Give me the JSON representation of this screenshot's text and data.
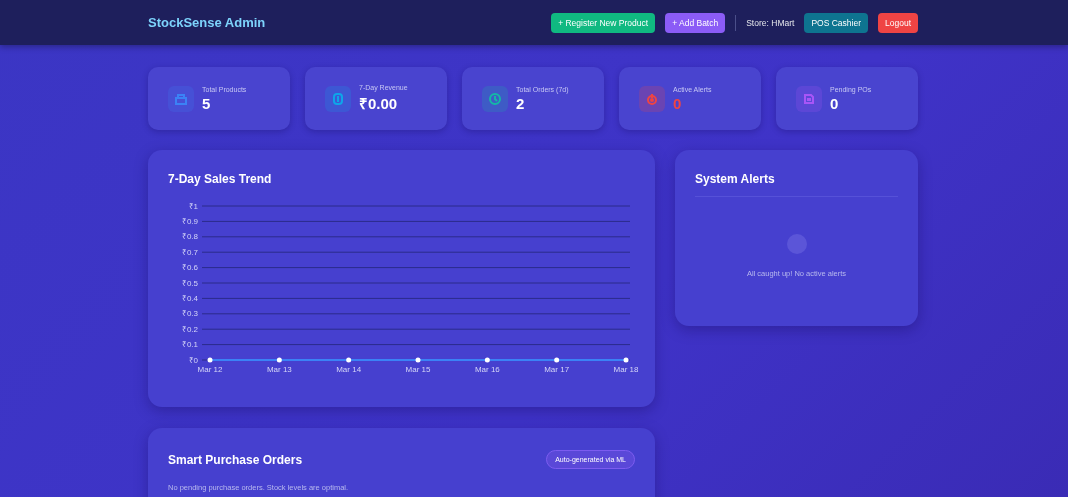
{
  "header": {
    "brand": "StockSense Admin",
    "actions": [
      {
        "label": "+ Register New Product",
        "kind": "green"
      },
      {
        "label": "+ Add Batch",
        "kind": "purple"
      }
    ],
    "store": "Store: HMart",
    "links": [
      {
        "label": "POS Cashier",
        "kind": "teal"
      },
      {
        "label": "Logout",
        "kind": "red"
      }
    ]
  },
  "stats": [
    {
      "label": "Total Products",
      "value": "5",
      "kind": "box",
      "color": "#3b82f6"
    },
    {
      "label": "7-Day Revenue",
      "value": "₹0.00",
      "kind": "coin",
      "color": "#0ea5e9"
    },
    {
      "label": "Total Orders (7d)",
      "value": "2",
      "kind": "clock",
      "color": "#14b8a6"
    },
    {
      "label": "Active Alerts",
      "value": "0",
      "kind": "alert",
      "color": "#ef4444"
    },
    {
      "label": "Pending POs",
      "value": "0",
      "kind": "doc",
      "color": "#a855f7"
    }
  ],
  "sales": {
    "title": "7-Day Sales Trend",
    "chart_data": {
      "type": "line",
      "categories": [
        "Mar 12",
        "Mar 13",
        "Mar 14",
        "Mar 15",
        "Mar 16",
        "Mar 17",
        "Mar 18"
      ],
      "series": [
        {
          "color": "#3b82f6",
          "values": [
            0,
            0,
            0,
            0,
            0,
            0,
            0
          ]
        }
      ],
      "ylim": [
        0,
        1
      ],
      "grid": true,
      "yticks": [
        {
          "value": 1,
          "label": "₹1"
        },
        {
          "value": 0.9,
          "label": "₹0.9"
        },
        {
          "value": 0.8,
          "label": "₹0.8"
        },
        {
          "value": 0.7,
          "label": "₹0.7"
        },
        {
          "value": 0.6,
          "label": "₹0.6"
        },
        {
          "value": 0.5,
          "label": "₹0.5"
        },
        {
          "value": 0.4,
          "label": "₹0.4"
        },
        {
          "value": 0.3,
          "label": "₹0.3"
        },
        {
          "value": 0.2,
          "label": "₹0.2"
        },
        {
          "value": 0.1,
          "label": "₹0.1"
        },
        {
          "value": 0,
          "label": "₹0"
        }
      ]
    }
  },
  "alerts": {
    "title": "System Alerts",
    "empty": "All caught up! No active alerts"
  },
  "purchase_orders": {
    "title": "Smart Purchase Orders",
    "badge": "Auto-generated via ML",
    "empty": "No pending purchase orders. Stock levels are optimal."
  }
}
